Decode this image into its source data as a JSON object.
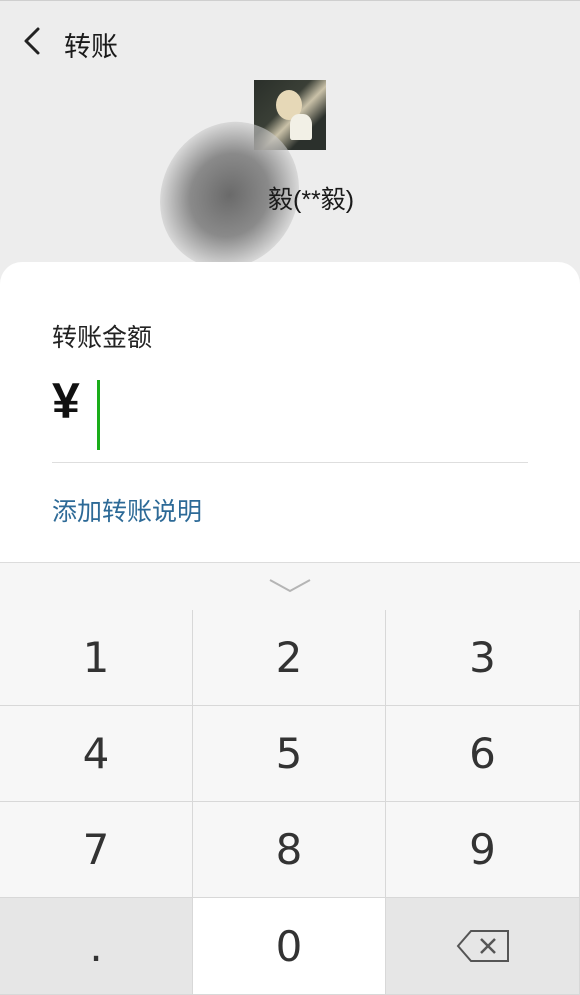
{
  "header": {
    "title": "转账"
  },
  "recipient": {
    "name": "毅(**毅)"
  },
  "transfer": {
    "amount_label": "转账金额",
    "currency_symbol": "¥",
    "amount_value": "",
    "add_note_label": "添加转账说明"
  },
  "keypad": {
    "keys": [
      "1",
      "2",
      "3",
      "4",
      "5",
      "6",
      "7",
      "8",
      "9",
      ".",
      "0"
    ],
    "delete_icon": "backspace-icon",
    "collapse_icon": "chevron-down-icon"
  },
  "colors": {
    "accent_green": "#1aad19",
    "link_blue": "#2d6a97"
  }
}
